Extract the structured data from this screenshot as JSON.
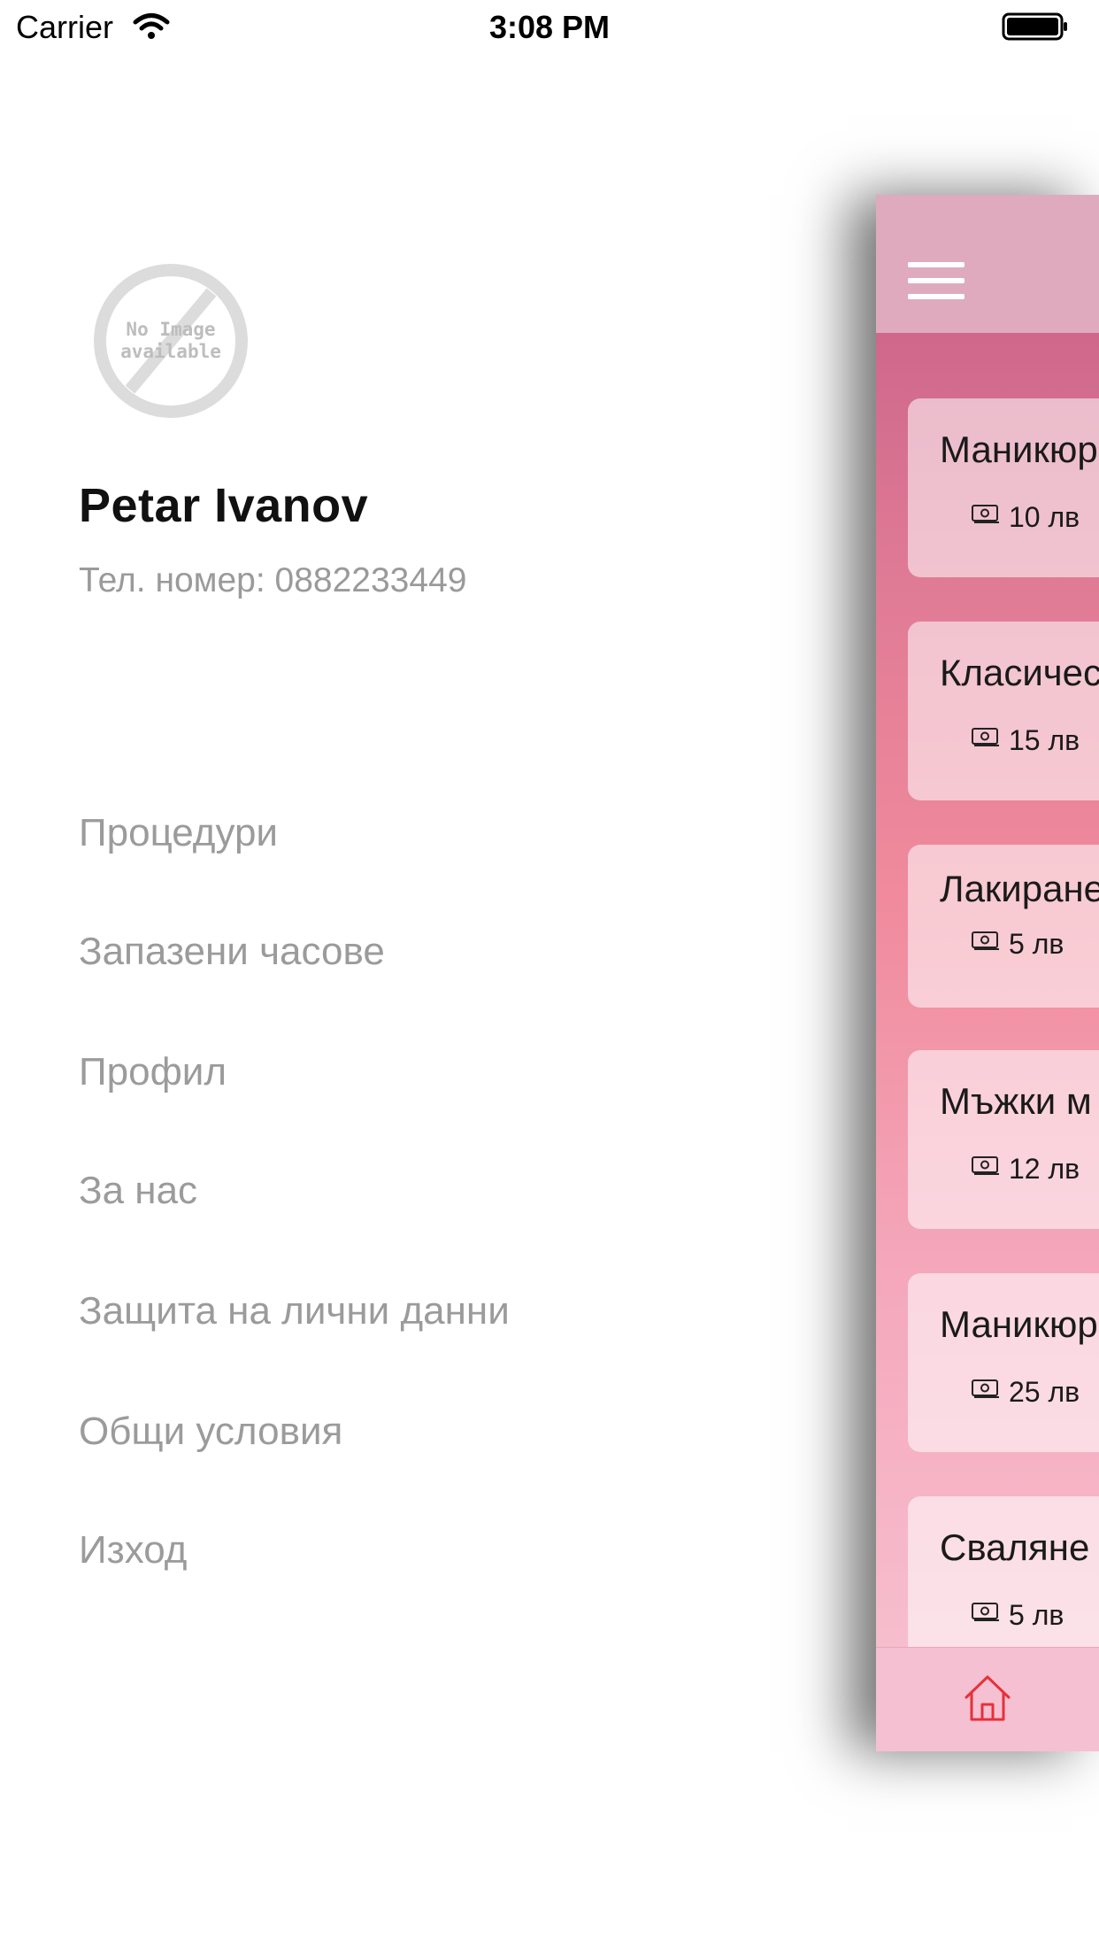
{
  "status_bar": {
    "carrier": "Carrier",
    "time": "3:08 PM"
  },
  "profile": {
    "avatar_text_line1": "No Image",
    "avatar_text_line2": "available",
    "name": "Petar Ivanov",
    "phone": "Тел. номер: 0882233449"
  },
  "menu": {
    "items": [
      {
        "label": "Процедури"
      },
      {
        "label": "Запазени часове"
      },
      {
        "label": "Профил"
      },
      {
        "label": "За нас"
      },
      {
        "label": "Защита на лични данни"
      },
      {
        "label": "Общи условия"
      },
      {
        "label": "Изход"
      }
    ]
  },
  "procedures": {
    "cards": [
      {
        "title": "Маникюр",
        "price": "10 лв"
      },
      {
        "title": "Класичес",
        "price": "15 лв"
      },
      {
        "title": "Лакиране",
        "price": "5 лв"
      },
      {
        "title": "Мъжки м",
        "price": "12 лв"
      },
      {
        "title": "Маникюр",
        "price": "25 лв"
      },
      {
        "title": "Сваляне",
        "price": "5 лв"
      }
    ]
  },
  "colors": {
    "accent_home": "#e8303a",
    "header": "#dfaabe",
    "panel_top": "#c55d85",
    "panel_bottom": "#f7c4d2"
  }
}
